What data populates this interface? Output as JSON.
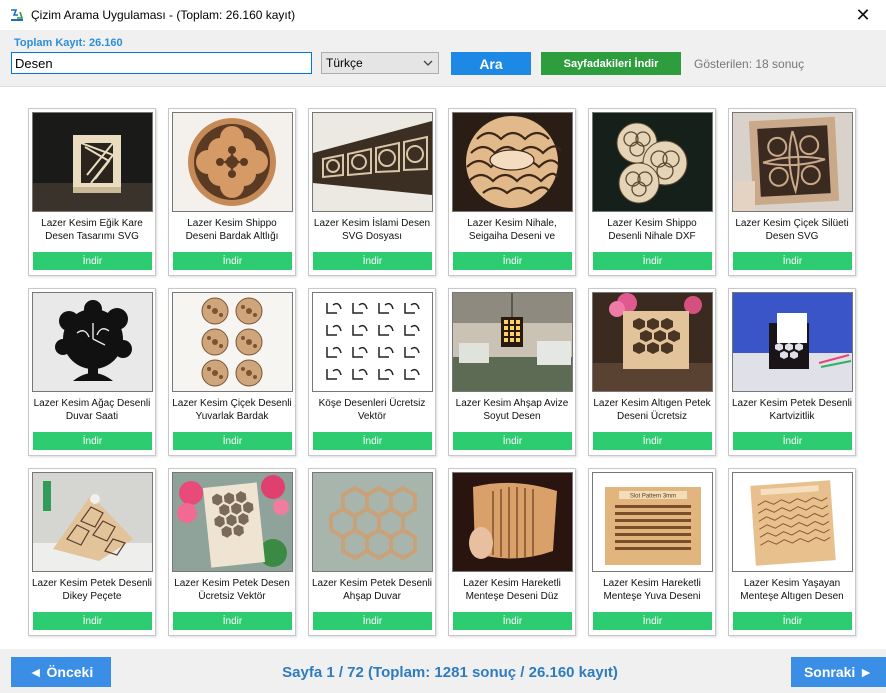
{
  "window": {
    "title": "Çizim Arama Uygulaması - (Toplam: 26.160 kayıt)",
    "icon": "app-logo-icon",
    "close_glyph": "✕"
  },
  "toolbar": {
    "total_label": "Toplam Kayıt: 26.160",
    "search_value": "Desen",
    "language_selected": "Türkçe",
    "search_button": "Ara",
    "download_page_button": "Sayfadakileri İndir",
    "shown_text": "Gösterilen: 18 sonuç"
  },
  "download_label": "İndir",
  "cards": [
    {
      "name": "Lazer Kesim Eğik Kare Desen Tasarımı SVG",
      "thumb": "box"
    },
    {
      "name": "Lazer Kesim Shippo Deseni Bardak Altlığı",
      "thumb": "shippo"
    },
    {
      "name": "Lazer Kesim İslami Desen SVG Dosyası",
      "thumb": "islamic"
    },
    {
      "name": "Lazer Kesim Nihale, Seigaiha Deseni ve",
      "thumb": "seigaiha"
    },
    {
      "name": "Lazer Kesim Shippo Desenli Nihale DXF",
      "thumb": "coasters"
    },
    {
      "name": "Lazer Kesim Çiçek Silüeti Desen SVG",
      "thumb": "flowerpanel"
    },
    {
      "name": "Lazer Kesim Ağaç Desenli Duvar Saati",
      "thumb": "treeclock"
    },
    {
      "name": "Lazer Kesim Çiçek Desenli Yuvarlak Bardak",
      "thumb": "roundcoasters"
    },
    {
      "name": "Köşe Desenleri Ücretsiz Vektör",
      "thumb": "corners"
    },
    {
      "name": "Lazer Kesim Ahşap Avize Soyut Desen",
      "thumb": "lamp"
    },
    {
      "name": "Lazer Kesim Altıgen Petek Deseni Ücretsiz",
      "thumb": "honeyholder"
    },
    {
      "name": "Lazer Kesim Petek Desenli Kartvizitlik",
      "thumb": "cardholder"
    },
    {
      "name": "Lazer Kesim Petek Desenli Dikey Peçete",
      "thumb": "napkin"
    },
    {
      "name": "Lazer Kesim Petek Desen Ücretsiz Vektör",
      "thumb": "hexpanel"
    },
    {
      "name": "Lazer Kesim Petek Desenli Ahşap Duvar",
      "thumb": "hexwall"
    },
    {
      "name": "Lazer Kesim Hareketli Menteşe Deseni Düz",
      "thumb": "hinge"
    },
    {
      "name": "Lazer Kesim Hareketli Menteşe Yuva Deseni",
      "thumb": "slotpattern"
    },
    {
      "name": "Lazer Kesim Yaşayan Menteşe Altıgen Desen",
      "thumb": "livinghinge"
    }
  ],
  "footer": {
    "prev_button": "◄ Önceki",
    "page_info": "Sayfa 1 / 72 (Toplam: 1281 sonuç / 26.160 kayıt)",
    "next_button": "Sonraki ►"
  },
  "colors": {
    "accent_blue": "#1e88e5",
    "download_green": "#2ecc71",
    "page_button_green": "#2e9d3e",
    "label_blue": "#2e8ed8"
  }
}
